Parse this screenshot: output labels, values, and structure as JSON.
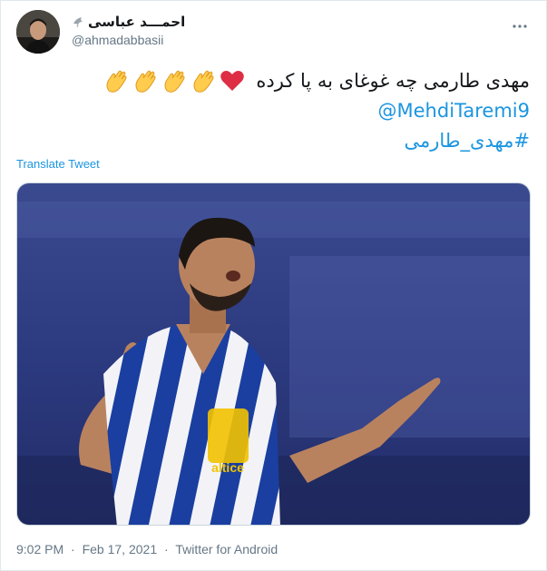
{
  "user": {
    "display_name": "احمـــد عباسی",
    "handle": "@ahmadabbasii",
    "avatar_icon": "avatar",
    "badge_icon": "dove-icon"
  },
  "more_icon": "more-horizontal-icon",
  "tweet": {
    "text": "مهدی طارمی چه غوغای به پا کرده",
    "emojis": [
      "heart-icon",
      "clap-icon",
      "clap-icon",
      "clap-icon",
      "clap-icon"
    ],
    "mention": "@MehdiTaremi9",
    "hashtag": "#مهدی_طارمی"
  },
  "translate_label": "Translate Tweet",
  "meta": {
    "time": "9:02 PM",
    "date": "Feb 17, 2021",
    "source": "Twitter for Android",
    "separator": "·"
  },
  "colors": {
    "link": "#1b95e0",
    "text": "#14171a",
    "muted": "#657786",
    "border": "#e1e8ed"
  }
}
